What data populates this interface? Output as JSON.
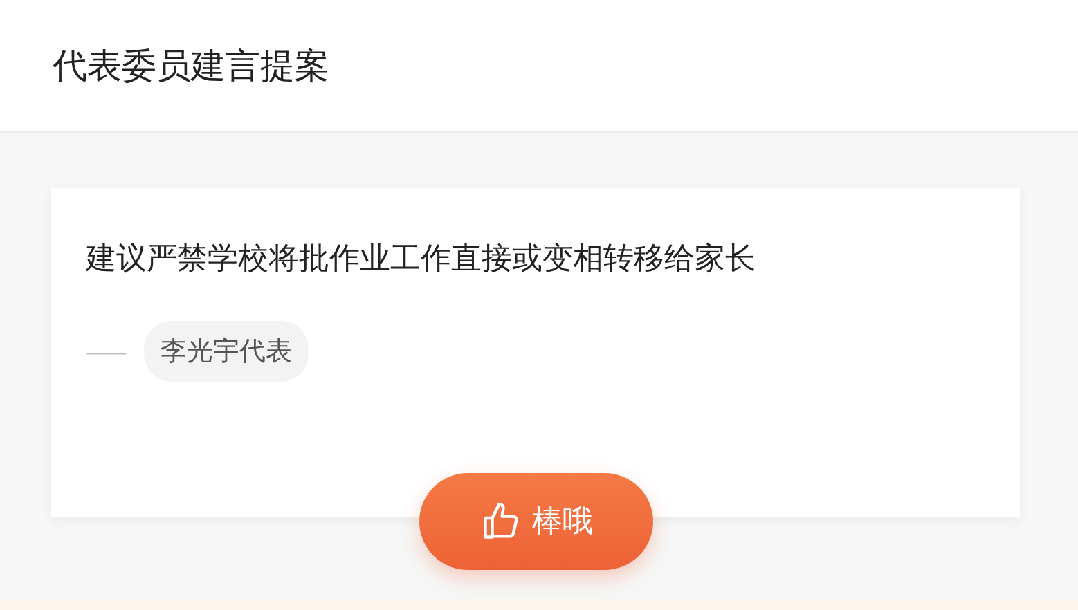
{
  "header": {
    "title": "代表委员建言提案"
  },
  "card": {
    "title": "建议严禁学校将批作业工作直接或变相转移给家长",
    "dash": "——",
    "author": "李光宇代表"
  },
  "like_button": {
    "label": "棒哦"
  }
}
